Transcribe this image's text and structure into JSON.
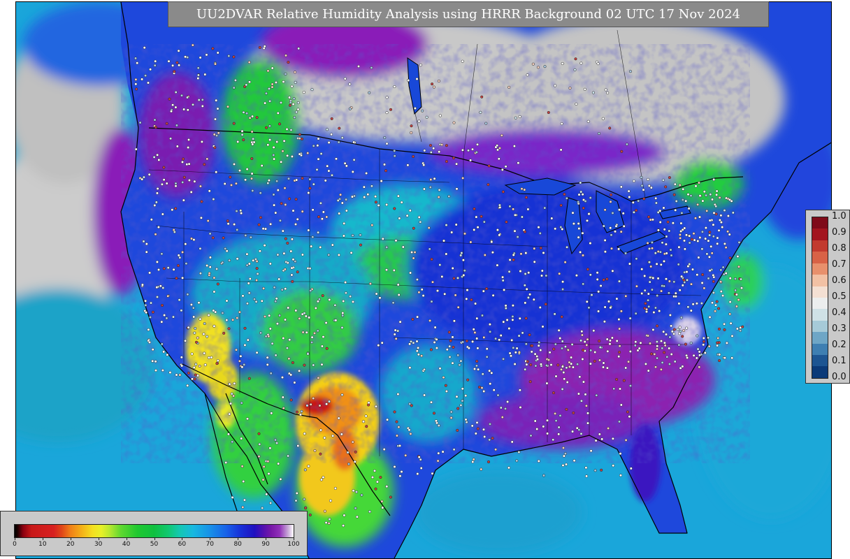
{
  "title": "UU2DVAR Relative Humidity Analysis using HRRR Background 02 UTC 17 Nov 2024",
  "rh_colorbar": {
    "ticks": [
      "0",
      "10",
      "20",
      "30",
      "40",
      "50",
      "60",
      "70",
      "80",
      "90",
      "100"
    ],
    "range": [
      0,
      100
    ]
  },
  "skill_colorbar": {
    "ticks": [
      "1.0",
      "0.9",
      "0.8",
      "0.7",
      "0.6",
      "0.5",
      "0.4",
      "0.3",
      "0.2",
      "0.1",
      "0.0"
    ],
    "colors": [
      "#7f0b1a",
      "#a3151f",
      "#c23a2e",
      "#d86246",
      "#e8906c",
      "#f2c1a4",
      "#f4e0d3",
      "#eceeee",
      "#cfe1e6",
      "#a6cad8",
      "#6ea6c6",
      "#3e7fb2",
      "#1d5592",
      "#0b3a78"
    ]
  },
  "colors": {
    "land_gray": "#c8c8c8",
    "water_cyan": "#19a8dc",
    "dry_yellow": "#f2e51a",
    "very_dry_red": "#c81818",
    "moist_blue": "#1e3cdc",
    "saturated_purple": "#8a18b4"
  }
}
